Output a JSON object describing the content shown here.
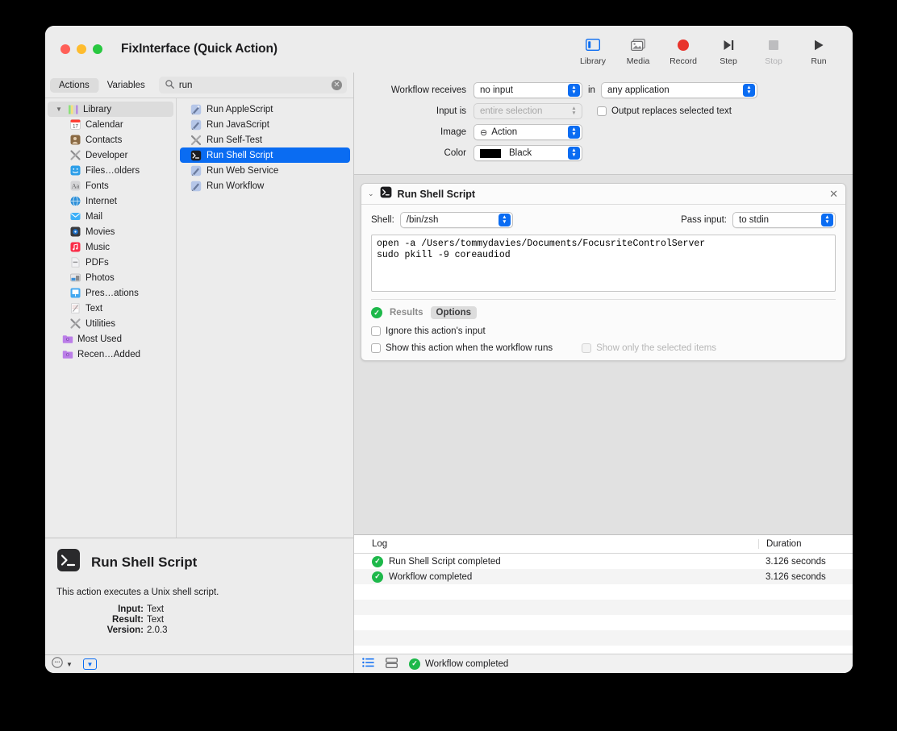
{
  "window": {
    "title": "FixInterface (Quick Action)",
    "traffic_lights": [
      "close",
      "minimize",
      "zoom"
    ]
  },
  "toolbar": {
    "items": [
      {
        "label": "Library",
        "icon": "library-icon",
        "enabled": true
      },
      {
        "label": "Media",
        "icon": "media-icon",
        "enabled": true
      },
      {
        "label": "Record",
        "icon": "record-icon",
        "enabled": true
      },
      {
        "label": "Step",
        "icon": "step-icon",
        "enabled": true
      },
      {
        "label": "Stop",
        "icon": "stop-icon",
        "enabled": false
      },
      {
        "label": "Run",
        "icon": "run-icon",
        "enabled": true
      }
    ]
  },
  "browser": {
    "tabs": [
      {
        "label": "Actions",
        "active": true
      },
      {
        "label": "Variables",
        "active": false
      }
    ],
    "search": {
      "value": "run",
      "placeholder": "Search",
      "icon": "search-icon",
      "clear_icon": "clear-icon"
    },
    "library": [
      {
        "label": "Library",
        "icon": "library-bars-icon",
        "level": 0,
        "selected": true,
        "disclosure": "⌄"
      },
      {
        "label": "Calendar",
        "icon": "calendar-icon",
        "level": 1
      },
      {
        "label": "Contacts",
        "icon": "contacts-icon",
        "level": 1
      },
      {
        "label": "Developer",
        "icon": "developer-icon",
        "level": 1
      },
      {
        "label": "Files…olders",
        "icon": "finder-icon",
        "level": 1
      },
      {
        "label": "Fonts",
        "icon": "fonts-icon",
        "level": 1
      },
      {
        "label": "Internet",
        "icon": "internet-icon",
        "level": 1
      },
      {
        "label": "Mail",
        "icon": "mail-icon",
        "level": 1
      },
      {
        "label": "Movies",
        "icon": "movies-icon",
        "level": 1
      },
      {
        "label": "Music",
        "icon": "music-icon",
        "level": 1
      },
      {
        "label": "PDFs",
        "icon": "pdf-icon",
        "level": 1
      },
      {
        "label": "Photos",
        "icon": "photos-icon",
        "level": 1
      },
      {
        "label": "Pres…ations",
        "icon": "presentations-icon",
        "level": 1
      },
      {
        "label": "Text",
        "icon": "text-icon",
        "level": 1
      },
      {
        "label": "Utilities",
        "icon": "utilities-icon",
        "level": 1
      },
      {
        "label": "Most Used",
        "icon": "smart-folder-icon",
        "level": 2
      },
      {
        "label": "Recen…Added",
        "icon": "smart-folder-icon",
        "level": 2
      }
    ],
    "actions": [
      {
        "label": "Run AppleScript",
        "icon": "script-icon",
        "selected": false
      },
      {
        "label": "Run JavaScript",
        "icon": "script-icon",
        "selected": false
      },
      {
        "label": "Run Self-Test",
        "icon": "xtools-icon",
        "selected": false
      },
      {
        "label": "Run Shell Script",
        "icon": "terminal-icon",
        "selected": true
      },
      {
        "label": "Run Web Service",
        "icon": "script-icon",
        "selected": false
      },
      {
        "label": "Run Workflow",
        "icon": "script-icon",
        "selected": false
      }
    ]
  },
  "info": {
    "icon": "terminal-icon",
    "title": "Run Shell Script",
    "description": "This action executes a Unix shell script.",
    "meta": [
      {
        "key": "Input:",
        "value": "Text"
      },
      {
        "key": "Result:",
        "value": "Text"
      },
      {
        "key": "Version:",
        "value": "2.0.3"
      }
    ]
  },
  "left_status_bar": {
    "info_icon": "info-circle-icon",
    "chevron_icon": "chevron-down-icon",
    "box_icon": "chevron-down-box-icon"
  },
  "workflow_settings": {
    "receives_label": "Workflow receives",
    "receives_value": "no input",
    "in_label": "in",
    "in_value": "any application",
    "input_is_label": "Input is",
    "input_is_value": "entire selection",
    "input_is_disabled": true,
    "output_replaces_label": "Output replaces selected text",
    "output_replaces_checked": false,
    "image_label": "Image",
    "image_value": "Action",
    "image_glyph": "⊖",
    "color_label": "Color",
    "color_value": "Black",
    "color_hex": "#000000"
  },
  "action_card": {
    "title": "Run Shell Script",
    "icon": "terminal-icon",
    "close_icon": "close-icon",
    "disclosure_icon": "chevron-down-icon",
    "shell_label": "Shell:",
    "shell_value": "/bin/zsh",
    "pass_input_label": "Pass input:",
    "pass_input_value": "to stdin",
    "script": "open -a /Users/tommydavies/Documents/FocusriteControlServer\nsudo pkill -9 coreaudiod",
    "results_tab": "Results",
    "options_tab": "Options",
    "options_active": true,
    "status_icon": "green-check-icon",
    "checkboxes": [
      {
        "label": "Ignore this action's input",
        "checked": false,
        "disabled": false
      },
      {
        "label": "Show this action when the workflow runs",
        "checked": false,
        "disabled": false
      },
      {
        "label": "Show only the selected items",
        "checked": false,
        "disabled": true
      }
    ]
  },
  "log": {
    "columns": [
      "Log",
      "Duration"
    ],
    "rows": [
      {
        "status_icon": "green-check-icon",
        "message": "Run Shell Script completed",
        "duration": "3.126 seconds"
      },
      {
        "status_icon": "green-check-icon",
        "message": "Workflow completed",
        "duration": "3.126 seconds"
      }
    ],
    "empty_rows": 5,
    "status_bar": {
      "list_icon": "list-view-icon",
      "panel_icon": "split-view-icon",
      "status_icon": "green-check-icon",
      "status_text": "Workflow completed"
    }
  },
  "colors": {
    "accent": "#0a6cf2",
    "success": "#1db84a",
    "record": "#e8342c",
    "window_bg": "#ececec",
    "canvas_bg": "#e1e1e1"
  }
}
